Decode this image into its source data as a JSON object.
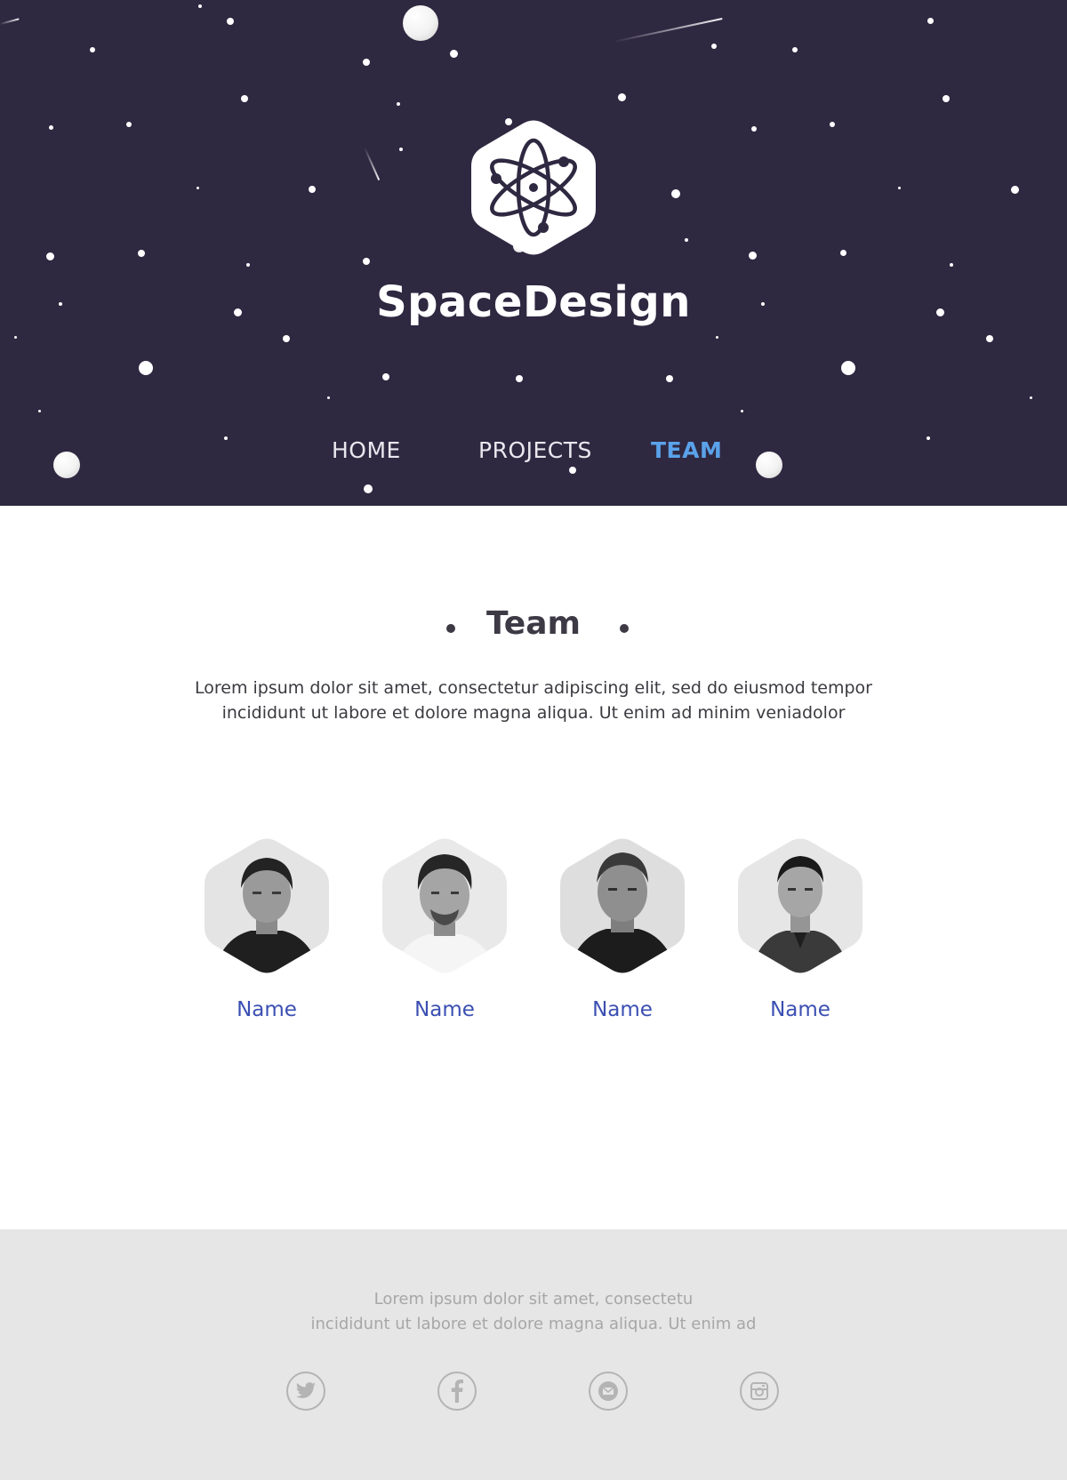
{
  "brand": {
    "name": "SpaceDesign",
    "logo_icon": "atom-icon"
  },
  "nav": {
    "items": [
      {
        "label": "HOME",
        "active": false
      },
      {
        "label": "PROJECTS",
        "active": false
      },
      {
        "label": "TEAM",
        "active": true
      }
    ]
  },
  "team": {
    "title": "Team",
    "description_lines": [
      "Lorem ipsum dolor sit amet, consectetur adipiscing elit, sed do eiusmod tempor",
      "incididunt ut labore et dolore magna aliqua. Ut enim ad minim veniadolor"
    ],
    "members": [
      {
        "name": "Name"
      },
      {
        "name": "Name"
      },
      {
        "name": "Name"
      },
      {
        "name": "Name"
      }
    ]
  },
  "footer": {
    "text_lines": [
      "Lorem ipsum dolor sit amet, consectetu",
      "incididunt ut labore et dolore magna aliqua. Ut enim ad"
    ],
    "social": [
      {
        "icon": "twitter-icon"
      },
      {
        "icon": "facebook-icon"
      },
      {
        "icon": "mail-icon"
      },
      {
        "icon": "instagram-icon"
      }
    ]
  },
  "colors": {
    "hero_bg": "#2f2841",
    "nav_active": "#5aa2ea",
    "member_name": "#3b4fb2",
    "footer_bg": "#e6e6e6"
  }
}
